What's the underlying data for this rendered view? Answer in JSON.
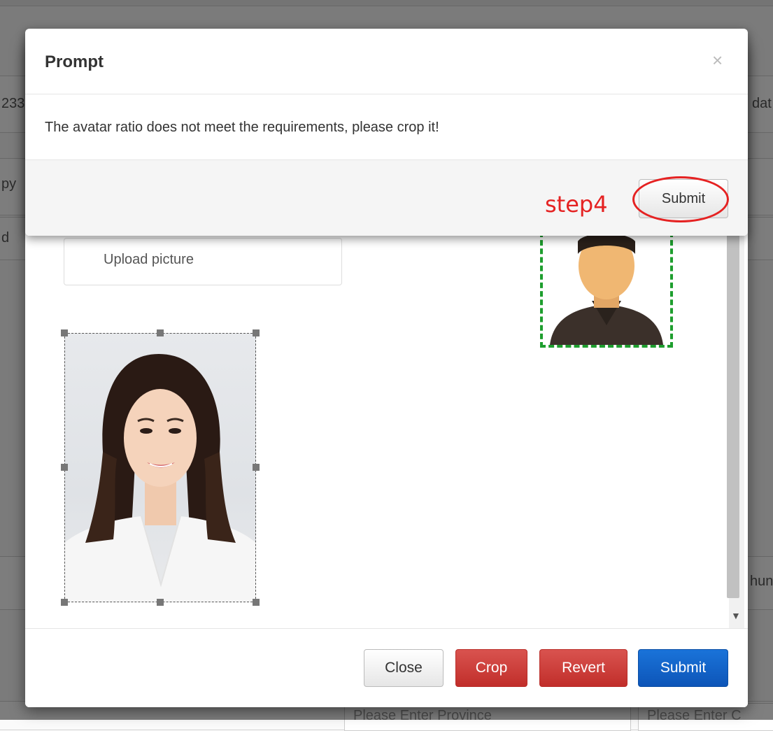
{
  "background": {
    "row_fragments": [
      "233",
      "dat",
      "py",
      "d",
      "hun"
    ],
    "input_placeholders": [
      "Please Enter Province",
      "Please Enter C"
    ]
  },
  "crop_dialog": {
    "upload_label": "Upload picture",
    "buttons": {
      "close": "Close",
      "crop": "Crop",
      "revert": "Revert",
      "submit": "Submit"
    },
    "colors": {
      "crop_button": "#d9534f",
      "submit_button": "#0d6efd",
      "preview_border": "#1e9e2e"
    }
  },
  "prompt_dialog": {
    "title": "Prompt",
    "close_glyph": "×",
    "message": "The avatar ratio does not meet the requirements, please crop it!",
    "submit_label": "Submit",
    "annotation": "step4",
    "annotation_color": "#e52222"
  }
}
